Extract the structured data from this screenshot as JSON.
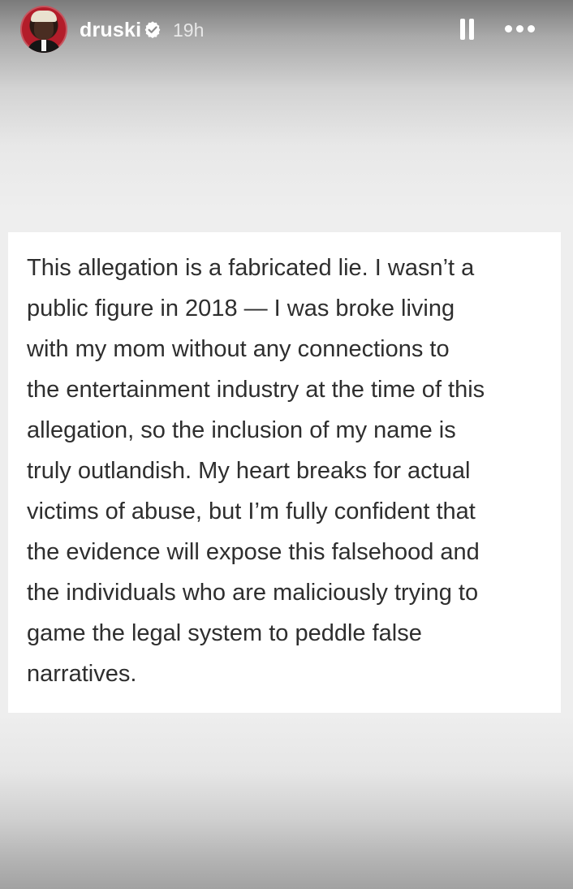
{
  "story": {
    "username": "druski",
    "time_ago": "19h",
    "avatar_icon": "profile-avatar-icon",
    "verified_icon": "verified-badge-icon",
    "pause_icon": "pause-icon",
    "more_icon": "more-options-icon"
  },
  "statement": {
    "lines": [
      "This allegation is a fabricated lie. I wasn’t a",
      "public figure in 2018 — I was broke living",
      "with my mom without any connections to",
      "the entertainment industry at the time of this",
      "allegation, so the inclusion of my name is",
      "truly outlandish. My heart breaks for actual",
      "victims of abuse, but I’m fully confident that",
      "the evidence will expose this falsehood and",
      "the individuals who are maliciously trying to",
      "game the legal system to peddle false",
      "narratives."
    ]
  },
  "colors": {
    "background": "#eeeeee",
    "card": "#ffffff",
    "text": "#2e2e2e",
    "header_text": "#ffffff"
  }
}
